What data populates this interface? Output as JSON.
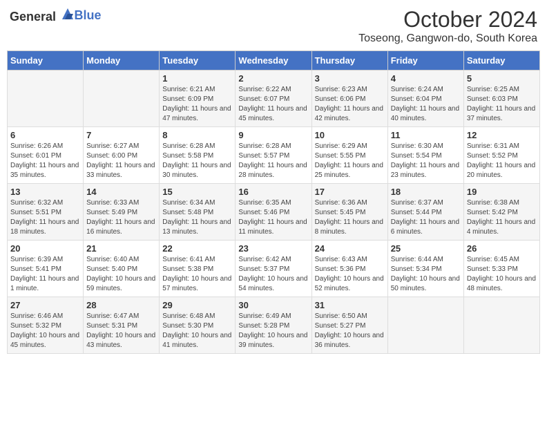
{
  "header": {
    "logo_general": "General",
    "logo_blue": "Blue",
    "month_title": "October 2024",
    "location": "Toseong, Gangwon-do, South Korea"
  },
  "days_of_week": [
    "Sunday",
    "Monday",
    "Tuesday",
    "Wednesday",
    "Thursday",
    "Friday",
    "Saturday"
  ],
  "weeks": [
    {
      "days": [
        {
          "num": "",
          "content": ""
        },
        {
          "num": "",
          "content": ""
        },
        {
          "num": "1",
          "content": "Sunrise: 6:21 AM\nSunset: 6:09 PM\nDaylight: 11 hours and 47 minutes."
        },
        {
          "num": "2",
          "content": "Sunrise: 6:22 AM\nSunset: 6:07 PM\nDaylight: 11 hours and 45 minutes."
        },
        {
          "num": "3",
          "content": "Sunrise: 6:23 AM\nSunset: 6:06 PM\nDaylight: 11 hours and 42 minutes."
        },
        {
          "num": "4",
          "content": "Sunrise: 6:24 AM\nSunset: 6:04 PM\nDaylight: 11 hours and 40 minutes."
        },
        {
          "num": "5",
          "content": "Sunrise: 6:25 AM\nSunset: 6:03 PM\nDaylight: 11 hours and 37 minutes."
        }
      ]
    },
    {
      "days": [
        {
          "num": "6",
          "content": "Sunrise: 6:26 AM\nSunset: 6:01 PM\nDaylight: 11 hours and 35 minutes."
        },
        {
          "num": "7",
          "content": "Sunrise: 6:27 AM\nSunset: 6:00 PM\nDaylight: 11 hours and 33 minutes."
        },
        {
          "num": "8",
          "content": "Sunrise: 6:28 AM\nSunset: 5:58 PM\nDaylight: 11 hours and 30 minutes."
        },
        {
          "num": "9",
          "content": "Sunrise: 6:28 AM\nSunset: 5:57 PM\nDaylight: 11 hours and 28 minutes."
        },
        {
          "num": "10",
          "content": "Sunrise: 6:29 AM\nSunset: 5:55 PM\nDaylight: 11 hours and 25 minutes."
        },
        {
          "num": "11",
          "content": "Sunrise: 6:30 AM\nSunset: 5:54 PM\nDaylight: 11 hours and 23 minutes."
        },
        {
          "num": "12",
          "content": "Sunrise: 6:31 AM\nSunset: 5:52 PM\nDaylight: 11 hours and 20 minutes."
        }
      ]
    },
    {
      "days": [
        {
          "num": "13",
          "content": "Sunrise: 6:32 AM\nSunset: 5:51 PM\nDaylight: 11 hours and 18 minutes."
        },
        {
          "num": "14",
          "content": "Sunrise: 6:33 AM\nSunset: 5:49 PM\nDaylight: 11 hours and 16 minutes."
        },
        {
          "num": "15",
          "content": "Sunrise: 6:34 AM\nSunset: 5:48 PM\nDaylight: 11 hours and 13 minutes."
        },
        {
          "num": "16",
          "content": "Sunrise: 6:35 AM\nSunset: 5:46 PM\nDaylight: 11 hours and 11 minutes."
        },
        {
          "num": "17",
          "content": "Sunrise: 6:36 AM\nSunset: 5:45 PM\nDaylight: 11 hours and 8 minutes."
        },
        {
          "num": "18",
          "content": "Sunrise: 6:37 AM\nSunset: 5:44 PM\nDaylight: 11 hours and 6 minutes."
        },
        {
          "num": "19",
          "content": "Sunrise: 6:38 AM\nSunset: 5:42 PM\nDaylight: 11 hours and 4 minutes."
        }
      ]
    },
    {
      "days": [
        {
          "num": "20",
          "content": "Sunrise: 6:39 AM\nSunset: 5:41 PM\nDaylight: 11 hours and 1 minute."
        },
        {
          "num": "21",
          "content": "Sunrise: 6:40 AM\nSunset: 5:40 PM\nDaylight: 10 hours and 59 minutes."
        },
        {
          "num": "22",
          "content": "Sunrise: 6:41 AM\nSunset: 5:38 PM\nDaylight: 10 hours and 57 minutes."
        },
        {
          "num": "23",
          "content": "Sunrise: 6:42 AM\nSunset: 5:37 PM\nDaylight: 10 hours and 54 minutes."
        },
        {
          "num": "24",
          "content": "Sunrise: 6:43 AM\nSunset: 5:36 PM\nDaylight: 10 hours and 52 minutes."
        },
        {
          "num": "25",
          "content": "Sunrise: 6:44 AM\nSunset: 5:34 PM\nDaylight: 10 hours and 50 minutes."
        },
        {
          "num": "26",
          "content": "Sunrise: 6:45 AM\nSunset: 5:33 PM\nDaylight: 10 hours and 48 minutes."
        }
      ]
    },
    {
      "days": [
        {
          "num": "27",
          "content": "Sunrise: 6:46 AM\nSunset: 5:32 PM\nDaylight: 10 hours and 45 minutes."
        },
        {
          "num": "28",
          "content": "Sunrise: 6:47 AM\nSunset: 5:31 PM\nDaylight: 10 hours and 43 minutes."
        },
        {
          "num": "29",
          "content": "Sunrise: 6:48 AM\nSunset: 5:30 PM\nDaylight: 10 hours and 41 minutes."
        },
        {
          "num": "30",
          "content": "Sunrise: 6:49 AM\nSunset: 5:28 PM\nDaylight: 10 hours and 39 minutes."
        },
        {
          "num": "31",
          "content": "Sunrise: 6:50 AM\nSunset: 5:27 PM\nDaylight: 10 hours and 36 minutes."
        },
        {
          "num": "",
          "content": ""
        },
        {
          "num": "",
          "content": ""
        }
      ]
    }
  ]
}
